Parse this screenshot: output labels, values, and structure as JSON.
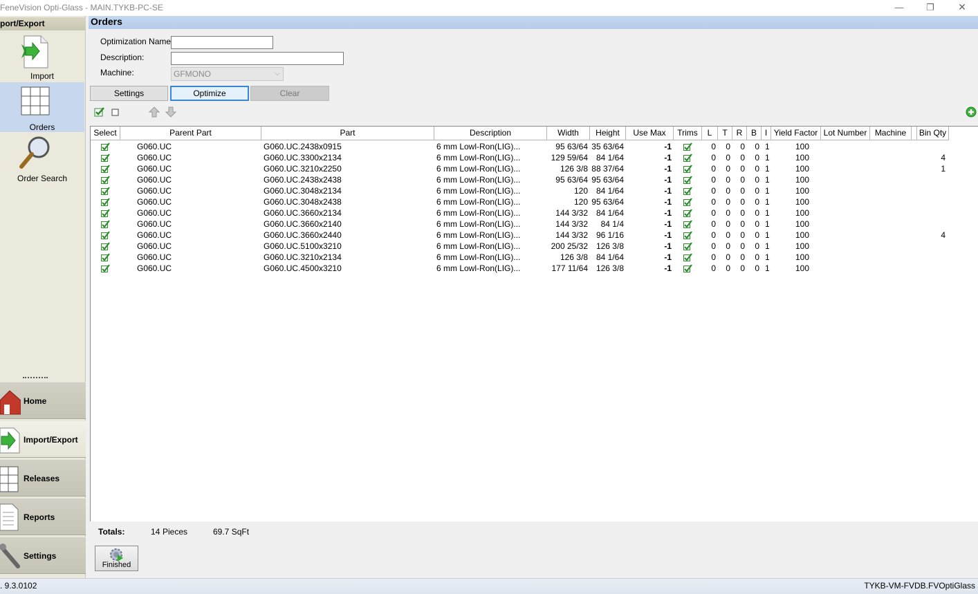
{
  "window": {
    "title": "FeneVision Opti-Glass - MAIN.TYKB-PC-SE",
    "minimize": "—",
    "maximize": "❐",
    "close": "✕"
  },
  "sidebar": {
    "header": "port/Export",
    "items": [
      {
        "label": "Import",
        "icon": "import-icon"
      },
      {
        "label": "Orders",
        "icon": "orders-grid-icon"
      },
      {
        "label": "Order Search",
        "icon": "magnifier-icon"
      }
    ],
    "nav": [
      {
        "label": "Home",
        "icon": "house-icon"
      },
      {
        "label": "Import/Export",
        "icon": "import-export-icon"
      },
      {
        "label": "Releases",
        "icon": "releases-icon"
      },
      {
        "label": "Reports",
        "icon": "reports-icon"
      },
      {
        "label": "Settings",
        "icon": "wrench-icon"
      }
    ]
  },
  "main": {
    "title": "Orders",
    "form": {
      "opt_name_label": "Optimization Name:",
      "opt_name_value": "",
      "description_label": "Description:",
      "description_value": "",
      "machine_label": "Machine:",
      "machine_value": "GFMONO"
    },
    "buttons": {
      "settings": "Settings",
      "optimize": "Optimize",
      "clear": "Clear"
    },
    "columns": [
      "Select",
      "Parent Part",
      "Part",
      "Description",
      "Width",
      "Height",
      "Use Max",
      "Trims",
      "L",
      "T",
      "R",
      "B",
      "I",
      "Yield Factor",
      "Lot Number",
      "Machine",
      "",
      "Bin Qty"
    ],
    "rows": [
      {
        "parent": "G060.UC",
        "part": "G060.UC.2438x0915",
        "desc": "6 mm Lowl-Ron(LIG)...",
        "width": "95 63/64",
        "height": "35 63/64",
        "usemax": "-1",
        "l": "0",
        "t": "0",
        "r": "0",
        "b": "0",
        "i": "1",
        "yield": "100",
        "lot": "",
        "machine": "",
        "binqty": ""
      },
      {
        "parent": "G060.UC",
        "part": "G060.UC.3300x2134",
        "desc": "6 mm Lowl-Ron(LIG)...",
        "width": "129 59/64",
        "height": "84 1/64",
        "usemax": "-1",
        "l": "0",
        "t": "0",
        "r": "0",
        "b": "0",
        "i": "1",
        "yield": "100",
        "lot": "",
        "machine": "",
        "binqty": "4"
      },
      {
        "parent": "G060.UC",
        "part": "G060.UC.3210x2250",
        "desc": "6 mm Lowl-Ron(LIG)...",
        "width": "126 3/8",
        "height": "88 37/64",
        "usemax": "-1",
        "l": "0",
        "t": "0",
        "r": "0",
        "b": "0",
        "i": "1",
        "yield": "100",
        "lot": "",
        "machine": "",
        "binqty": "1"
      },
      {
        "parent": "G060.UC",
        "part": "G060.UC.2438x2438",
        "desc": "6 mm Lowl-Ron(LIG)...",
        "width": "95 63/64",
        "height": "95 63/64",
        "usemax": "-1",
        "l": "0",
        "t": "0",
        "r": "0",
        "b": "0",
        "i": "1",
        "yield": "100",
        "lot": "",
        "machine": "",
        "binqty": ""
      },
      {
        "parent": "G060.UC",
        "part": "G060.UC.3048x2134",
        "desc": "6 mm Lowl-Ron(LIG)...",
        "width": "120",
        "height": "84 1/64",
        "usemax": "-1",
        "l": "0",
        "t": "0",
        "r": "0",
        "b": "0",
        "i": "1",
        "yield": "100",
        "lot": "",
        "machine": "",
        "binqty": ""
      },
      {
        "parent": "G060.UC",
        "part": "G060.UC.3048x2438",
        "desc": "6 mm Lowl-Ron(LIG)...",
        "width": "120",
        "height": "95 63/64",
        "usemax": "-1",
        "l": "0",
        "t": "0",
        "r": "0",
        "b": "0",
        "i": "1",
        "yield": "100",
        "lot": "",
        "machine": "",
        "binqty": ""
      },
      {
        "parent": "G060.UC",
        "part": "G060.UC.3660x2134",
        "desc": "6 mm Lowl-Ron(LIG)...",
        "width": "144 3/32",
        "height": "84 1/64",
        "usemax": "-1",
        "l": "0",
        "t": "0",
        "r": "0",
        "b": "0",
        "i": "1",
        "yield": "100",
        "lot": "",
        "machine": "",
        "binqty": ""
      },
      {
        "parent": "G060.UC",
        "part": "G060.UC.3660x2140",
        "desc": "6 mm Lowl-Ron(LIG)...",
        "width": "144 3/32",
        "height": "84 1/4",
        "usemax": "-1",
        "l": "0",
        "t": "0",
        "r": "0",
        "b": "0",
        "i": "1",
        "yield": "100",
        "lot": "",
        "machine": "",
        "binqty": ""
      },
      {
        "parent": "G060.UC",
        "part": "G060.UC.3660x2440",
        "desc": "6 mm Lowl-Ron(LIG)...",
        "width": "144 3/32",
        "height": "96 1/16",
        "usemax": "-1",
        "l": "0",
        "t": "0",
        "r": "0",
        "b": "0",
        "i": "1",
        "yield": "100",
        "lot": "",
        "machine": "",
        "binqty": "4"
      },
      {
        "parent": "G060.UC",
        "part": "G060.UC.5100x3210",
        "desc": "6 mm Lowl-Ron(LIG)...",
        "width": "200 25/32",
        "height": "126 3/8",
        "usemax": "-1",
        "l": "0",
        "t": "0",
        "r": "0",
        "b": "0",
        "i": "1",
        "yield": "100",
        "lot": "",
        "machine": "",
        "binqty": ""
      },
      {
        "parent": "G060.UC",
        "part": "G060.UC.3210x2134",
        "desc": "6 mm Lowl-Ron(LIG)...",
        "width": "126 3/8",
        "height": "84 1/64",
        "usemax": "-1",
        "l": "0",
        "t": "0",
        "r": "0",
        "b": "0",
        "i": "1",
        "yield": "100",
        "lot": "",
        "machine": "",
        "binqty": ""
      },
      {
        "parent": "G060.UC",
        "part": "G060.UC.4500x3210",
        "desc": "6 mm Lowl-Ron(LIG)...",
        "width": "177 11/64",
        "height": "126 3/8",
        "usemax": "-1",
        "l": "0",
        "t": "0",
        "r": "0",
        "b": "0",
        "i": "1",
        "yield": "100",
        "lot": "",
        "machine": "",
        "binqty": ""
      }
    ],
    "totals": {
      "label": "Totals:",
      "pieces_count": "14",
      "pieces_unit": "Pieces",
      "area": "69.7 SqFt"
    },
    "finished_label": "Finished"
  },
  "status": {
    "version": ". 9.3.0102",
    "server": "TYKB-VM-FVDB.FVOptiGlass"
  },
  "colors": {
    "check_green": "#2e8b2e",
    "header_blue": "#b4cbea",
    "accent": "#3a86d6"
  }
}
